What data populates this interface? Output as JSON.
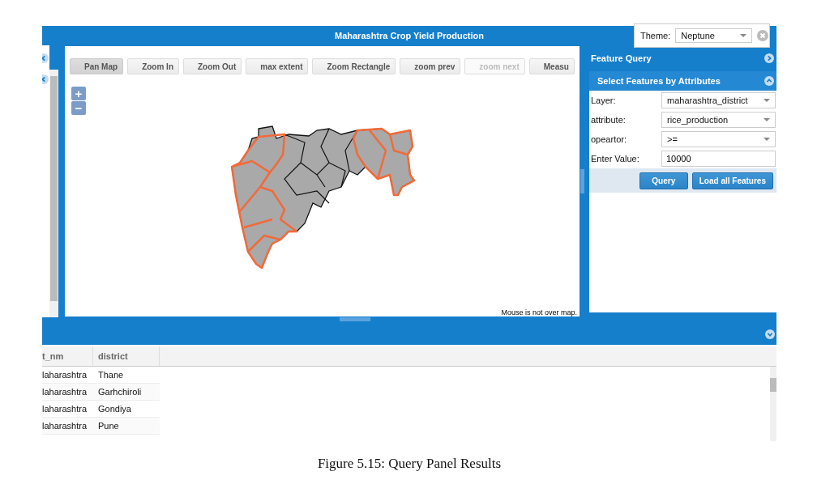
{
  "window": {
    "title": "Maharashtra Crop Yield Production"
  },
  "theme": {
    "label": "Theme:",
    "value": "Neptune"
  },
  "toolbar": [
    {
      "label": "Pan Map",
      "selected": true,
      "disabled": false
    },
    {
      "label": "Zoom In",
      "selected": false,
      "disabled": false
    },
    {
      "label": "Zoom Out",
      "selected": false,
      "disabled": false
    },
    {
      "label": "max extent",
      "selected": false,
      "disabled": false
    },
    {
      "label": "Zoom Rectangle",
      "selected": false,
      "disabled": false
    },
    {
      "label": "zoom prev",
      "selected": false,
      "disabled": false
    },
    {
      "label": "zoom next",
      "selected": false,
      "disabled": true
    },
    {
      "label": "Measu",
      "selected": false,
      "disabled": false
    }
  ],
  "zoom_controls": [
    "+",
    "−"
  ],
  "map": {
    "status": "Mouse is not over map."
  },
  "query_panel": {
    "title": "Feature Query",
    "section": "Select Features by Attributes",
    "expanded": true,
    "fields": [
      {
        "label": "Layer:",
        "value": "maharashtra_district",
        "kind": "combo"
      },
      {
        "label": "attribute:",
        "value": "rice_production",
        "kind": "combo"
      },
      {
        "label": "opeartor:",
        "value": ">=",
        "kind": "combo"
      },
      {
        "label": "Enter Value:",
        "value": "10000",
        "kind": "text"
      }
    ],
    "buttons": [
      "Query",
      "Load all Features"
    ]
  },
  "results": {
    "columns": [
      "t_nm",
      "district"
    ],
    "rows": [
      [
        "laharashtra",
        "Thane"
      ],
      [
        "laharashtra",
        "Garhchiroli"
      ],
      [
        "laharashtra",
        "Gondiya"
      ],
      [
        "laharashtra",
        "Pune"
      ]
    ]
  },
  "caption": "Figure 5.15: Query Panel Results"
}
